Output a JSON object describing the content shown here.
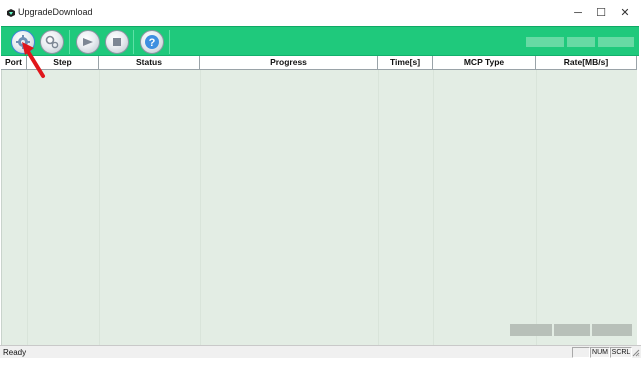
{
  "window": {
    "title": "UpgradeDownload",
    "controls": {
      "minimize": "─",
      "maximize": "☐",
      "close": "✕"
    }
  },
  "toolbar": {
    "background": "#1fc97c",
    "buttons": [
      {
        "name": "settings-button",
        "icon": "gear-icon",
        "active": true
      },
      {
        "name": "config-button",
        "icon": "gears-icon"
      },
      {
        "name": "start-button",
        "icon": "play-icon"
      },
      {
        "name": "stop-button",
        "icon": "stop-icon"
      },
      {
        "name": "help-button",
        "icon": "question-icon",
        "glyph": "?"
      }
    ]
  },
  "table": {
    "columns": [
      "Port",
      "Step",
      "Status",
      "Progress",
      "Time[s]",
      "MCP Type",
      "Rate[MB/s]"
    ],
    "rows": []
  },
  "statusbar": {
    "text": "Ready",
    "panes": [
      "",
      "NUM",
      "SCRL"
    ]
  },
  "colors": {
    "list_background": "#e3ede4",
    "annotation_arrow": "#e0161b"
  }
}
